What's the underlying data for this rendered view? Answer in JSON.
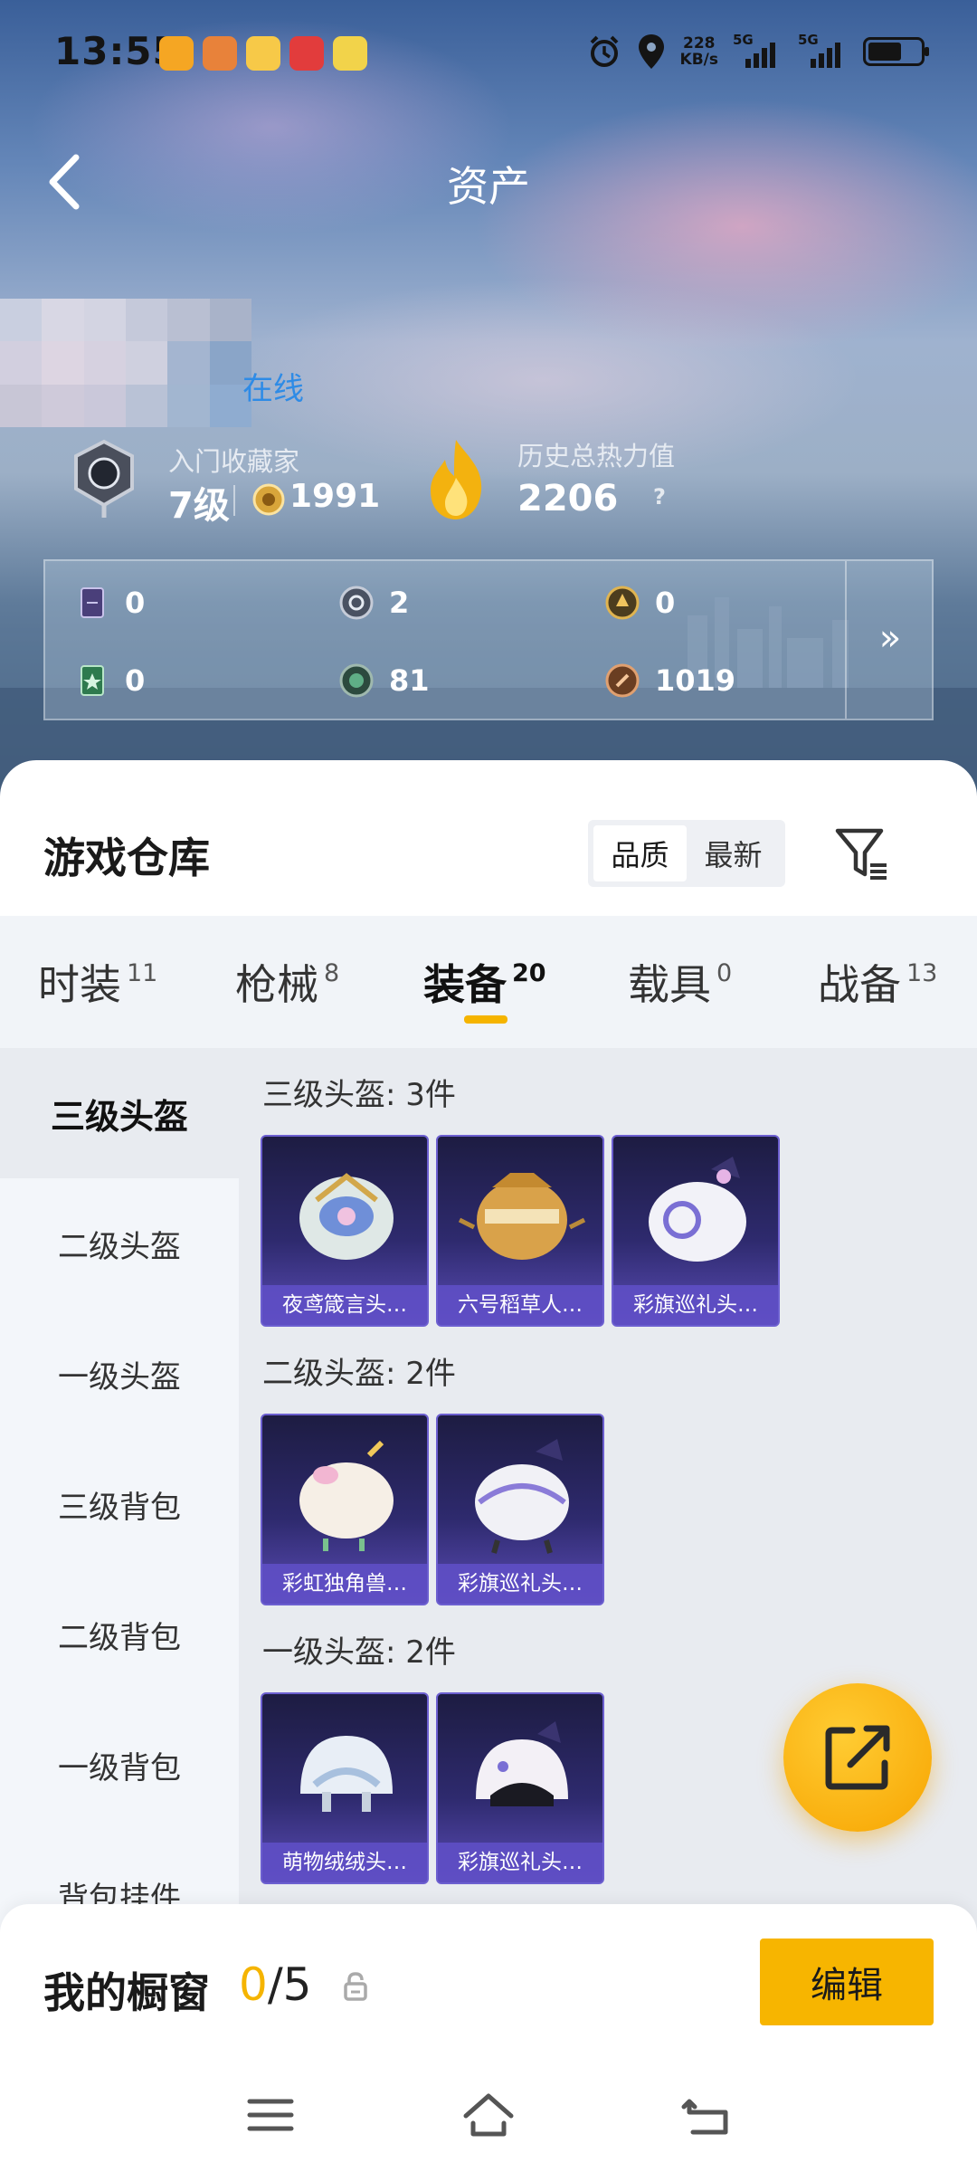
{
  "status_bar": {
    "time": "13:55",
    "net_speed_value": "228",
    "net_speed_unit": "KB/s",
    "sim1": "5G",
    "sim2": "5G",
    "icons": [
      "alarm-icon",
      "location-icon",
      "battery-icon"
    ]
  },
  "header": {
    "title": "资产"
  },
  "profile": {
    "online_status": "在线",
    "rank_title": "入门收藏家",
    "rank_level": "7级",
    "rank_points": "1991",
    "heat_title": "历史总热力值",
    "heat_value": "2206",
    "heat_help": "?"
  },
  "stats": [
    {
      "icon": "purple-card-icon",
      "value": "0"
    },
    {
      "icon": "silver-coin-icon",
      "value": "2"
    },
    {
      "icon": "gold-coin-icon",
      "value": "0"
    },
    {
      "icon": "green-card-icon",
      "value": "0"
    },
    {
      "icon": "green-orb-icon",
      "value": "81"
    },
    {
      "icon": "bronze-coin-icon",
      "value": "1019"
    }
  ],
  "stats_more": "»",
  "warehouse": {
    "title": "游戏仓库",
    "sort_options": [
      "品质",
      "最新"
    ],
    "sort_active": "品质"
  },
  "tabs": [
    {
      "label": "时装",
      "count": "11"
    },
    {
      "label": "枪械",
      "count": "8"
    },
    {
      "label": "装备",
      "count": "20",
      "active": true
    },
    {
      "label": "载具",
      "count": "0"
    },
    {
      "label": "战备",
      "count": "13"
    }
  ],
  "sidebar": [
    {
      "label": "三级头盔",
      "active": true
    },
    {
      "label": "二级头盔"
    },
    {
      "label": "一级头盔"
    },
    {
      "label": "三级背包"
    },
    {
      "label": "二级背包"
    },
    {
      "label": "一级背包"
    },
    {
      "label": "背包挂件"
    }
  ],
  "sections": [
    {
      "title": "三级头盔: 3件",
      "items": [
        "夜鸢箴言头…",
        "六号稻草人…",
        "彩旗巡礼头…"
      ]
    },
    {
      "title": "二级头盔: 2件",
      "items": [
        "彩虹独角兽…",
        "彩旗巡礼头…"
      ]
    },
    {
      "title": "一级头盔: 2件",
      "items": [
        "萌物绒绒头…",
        "彩旗巡礼头…"
      ]
    }
  ],
  "showcase": {
    "title": "我的橱窗",
    "current": "0",
    "total": "/5",
    "edit_label": "编辑"
  },
  "colors": {
    "accent": "#f7b500",
    "online": "#2e8be6",
    "card_purple": "#5e4ec4"
  }
}
